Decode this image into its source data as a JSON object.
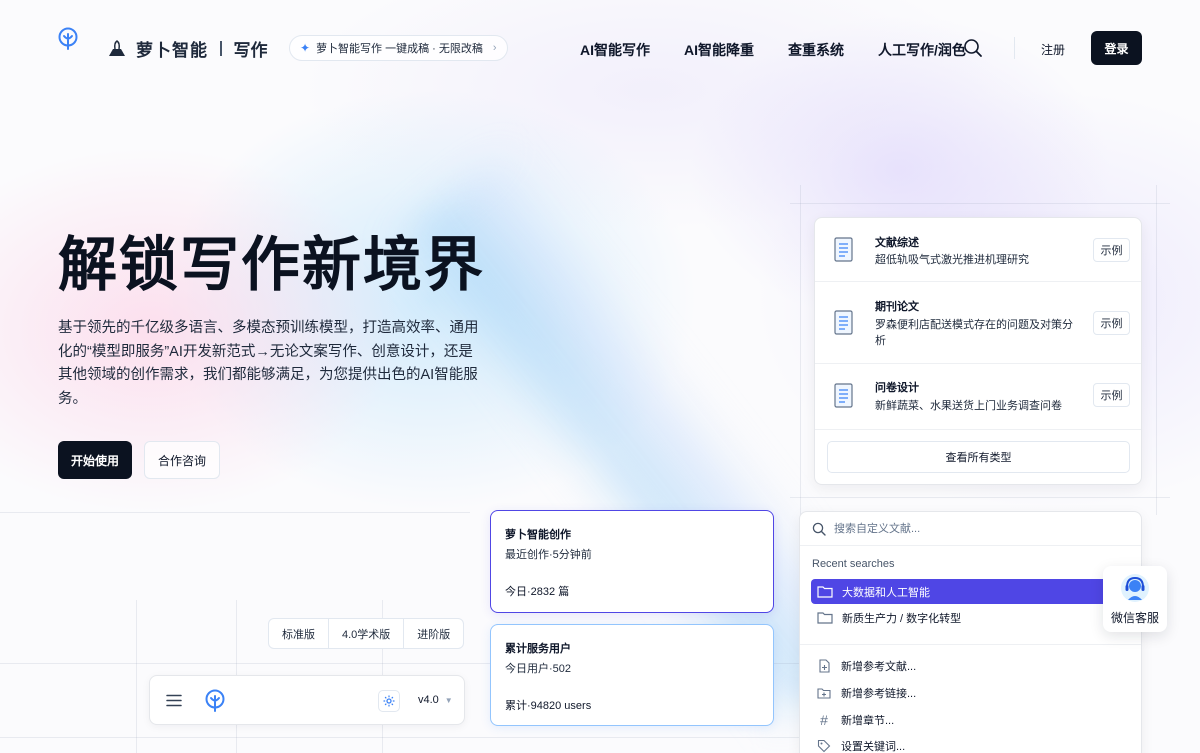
{
  "header": {
    "brand_name": "萝卜智能",
    "brand_sub": "写作",
    "promo": "萝卜智能写作 一键成稿 · 无限改稿",
    "nav": [
      "AI智能写作",
      "AI智能降重",
      "查重系统",
      "人工写作/润色"
    ],
    "register": "注册",
    "login": "登录"
  },
  "hero": {
    "title": "解锁写作新境界",
    "description": "基于领先的千亿级多语言、多模态预训练模型，打造高效率、通用化的“模型即服务”AI开发新范式→无论文案写作、创意设计，还是其他领域的创作需求，我们都能够满足，为您提供出色的AI智能服务。",
    "cta_primary": "开始使用",
    "cta_secondary": "合作咨询"
  },
  "doc_types": {
    "items": [
      {
        "title": "文献综述",
        "desc": "超低轨吸气式激光推进机理研究",
        "action": "示例"
      },
      {
        "title": "期刊论文",
        "desc": "罗森便利店配送模式存在的问题及对策分析",
        "action": "示例"
      },
      {
        "title": "问卷设计",
        "desc": "新鲜蔬菜、水果送货上门业务调查问卷",
        "action": "示例"
      }
    ],
    "view_all": "查看所有类型"
  },
  "stats": [
    {
      "title": "萝卜智能创作",
      "sub": "最近创作·5分钟前",
      "value": "今日·2832 篇"
    },
    {
      "title": "累计服务用户",
      "sub": "今日用户·502",
      "value": "累计·94820 users"
    }
  ],
  "versions": {
    "tabs": [
      "标准版",
      "4.0学术版",
      "进阶版"
    ],
    "selected": "v4.0"
  },
  "search": {
    "placeholder": "搜索自定义文献...",
    "recent_label": "Recent searches",
    "recent": [
      "大数据和人工智能",
      "新质生产力 / 数字化转型"
    ],
    "actions": [
      "新增参考文献...",
      "新增参考链接...",
      "新增章节...",
      "设置关键词..."
    ]
  },
  "support": {
    "label": "微信客服"
  },
  "colors": {
    "accent": "#4f46e5",
    "dark": "#0b1220",
    "light_blue": "#93c5fd"
  }
}
